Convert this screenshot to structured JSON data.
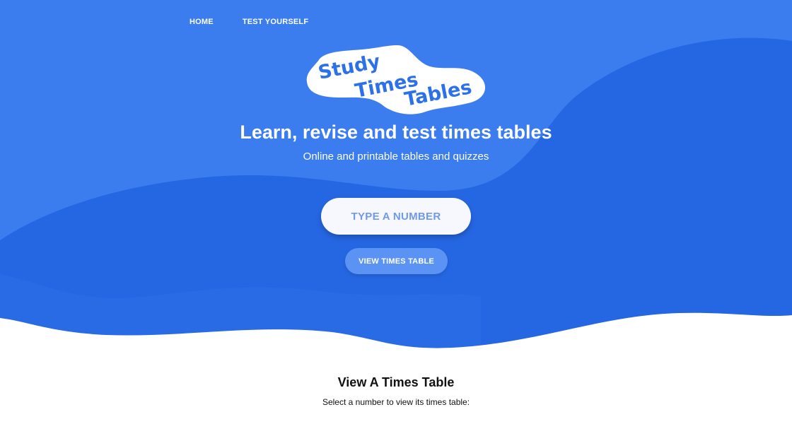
{
  "colors": {
    "hero_light_blue": "#3b7cee",
    "hero_dark_blue": "#2567e3",
    "button_blue": "#5b93f4",
    "input_text": "#6f99ee",
    "logo_text": "#2d71e8",
    "white": "#ffffff"
  },
  "nav": {
    "items": [
      {
        "label": "HOME"
      },
      {
        "label": "TEST YOURSELF"
      }
    ]
  },
  "logo": {
    "lines": [
      "Study",
      "Times",
      "Tables"
    ]
  },
  "hero": {
    "title": "Learn, revise and test times tables",
    "subtitle": "Online and printable tables and quizzes",
    "input_placeholder": "TYPE A NUMBER",
    "input_value": "",
    "button_label": "VIEW TIMES TABLE"
  },
  "section": {
    "heading": "View A Times Table",
    "text": "Select a number to view its times table:"
  }
}
